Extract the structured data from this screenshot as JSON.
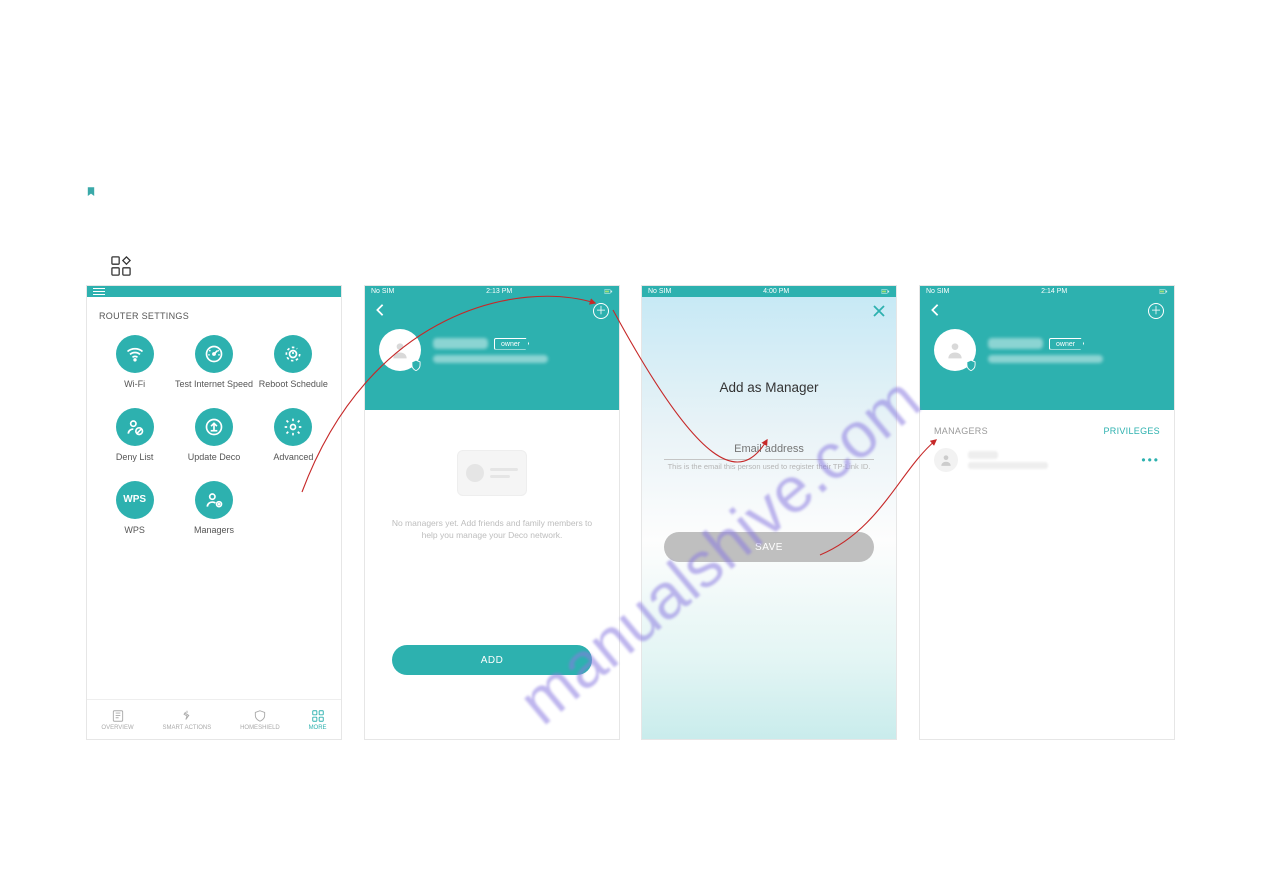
{
  "screen1": {
    "section_heading": "ROUTER SETTINGS",
    "items": {
      "wifi": "Wi-Fi",
      "speed": "Test Internet Speed",
      "reboot": "Reboot Schedule",
      "deny": "Deny List",
      "update": "Update Deco",
      "advanced": "Advanced",
      "wps": "WPS",
      "managers": "Managers"
    },
    "wps_text": "WPS",
    "bottom_nav": {
      "overview": "OVERVIEW",
      "smart": "SMART ACTIONS",
      "shield": "HOMESHIELD",
      "more": "MORE"
    }
  },
  "status": {
    "carrier": "No SIM",
    "t2": "2:13 PM",
    "t3": "4:00 PM",
    "t4": "2:14 PM"
  },
  "owner_badge": "owner",
  "screen2": {
    "empty_text": "No managers yet. Add friends and family members to help you manage your Deco network.",
    "add_label": "ADD"
  },
  "screen3": {
    "title": "Add as Manager",
    "placeholder": "Email address",
    "hint": "This is the email this person used to register their TP-Link ID.",
    "save_label": "SAVE"
  },
  "screen4": {
    "tab_managers": "MANAGERS",
    "tab_privileges": "PRIVILEGES",
    "dots": "•••"
  },
  "watermark": "manualshive.com"
}
